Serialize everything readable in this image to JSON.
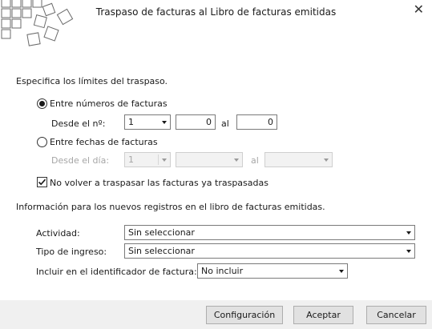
{
  "window": {
    "title": "Traspaso de facturas al Libro de facturas emitidas",
    "close_icon": "close-icon"
  },
  "limits": {
    "heading": "Especifica los límites del traspaso.",
    "option_invoice_numbers": {
      "label": "Entre números de facturas",
      "selected": true,
      "from_label": "Desde el nº:",
      "series_value": "1",
      "from_value": "0",
      "to_label": "al",
      "to_value": "0"
    },
    "option_invoice_dates": {
      "label": "Entre fechas de facturas",
      "selected": false,
      "from_label": "Desde el día:",
      "series_value": "1",
      "date_from_value": "",
      "to_label": "al",
      "date_to_value": ""
    },
    "skip_transferred": {
      "label": "No volver a traspasar las facturas ya traspasadas",
      "checked": true
    }
  },
  "new_records": {
    "heading": "Información para los nuevos registros en el libro de facturas emitidas.",
    "activity_label": "Actividad:",
    "activity_value": "Sin seleccionar",
    "income_type_label": "Tipo de ingreso:",
    "income_type_value": "Sin seleccionar",
    "include_in_id_label": "Incluir en el identificador de factura:",
    "include_in_id_value": "No incluir"
  },
  "footer": {
    "config_label": "Configuración",
    "accept_label": "Aceptar",
    "cancel_label": "Cancelar"
  }
}
